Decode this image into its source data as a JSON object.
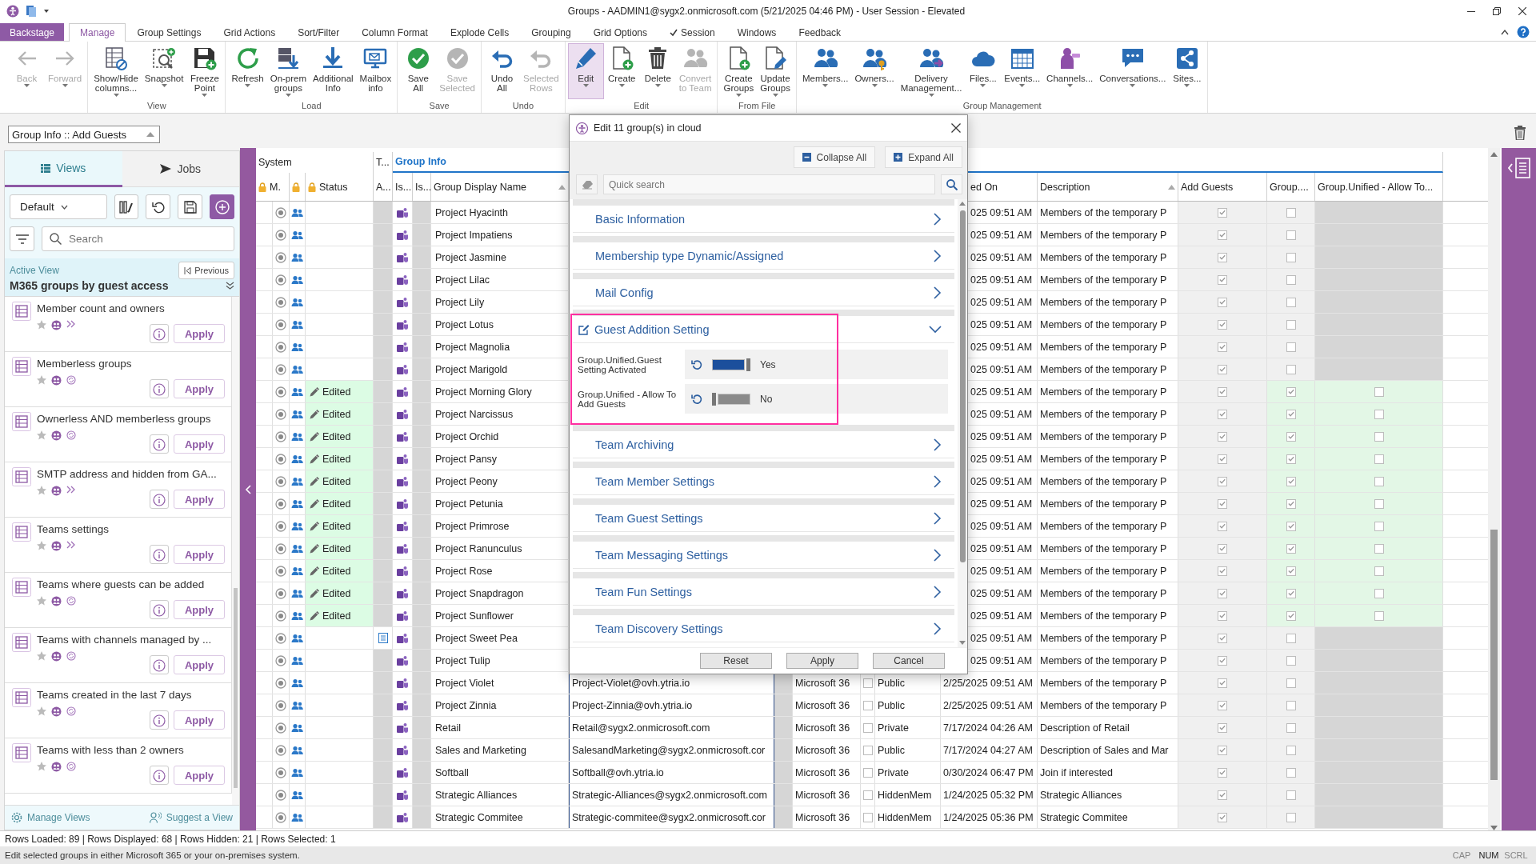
{
  "window": {
    "title": "Groups - AADMIN1@sygx2.onmicrosoft.com (5/21/2025 04:46 PM) - User Session - Elevated"
  },
  "menu": [
    {
      "label": "Backstage",
      "kind": "backstage",
      "selected": false,
      "checked": false
    },
    {
      "label": "Manage",
      "kind": "tab",
      "selected": true,
      "checked": false
    },
    {
      "label": "Group Settings",
      "kind": "tab",
      "selected": false,
      "checked": false
    },
    {
      "label": "Grid Actions",
      "kind": "tab",
      "selected": false,
      "checked": false
    },
    {
      "label": "Sort/Filter",
      "kind": "tab",
      "selected": false,
      "checked": false
    },
    {
      "label": "Column Format",
      "kind": "tab",
      "selected": false,
      "checked": false
    },
    {
      "label": "Explode Cells",
      "kind": "tab",
      "selected": false,
      "checked": false
    },
    {
      "label": "Grouping",
      "kind": "tab",
      "selected": false,
      "checked": false
    },
    {
      "label": "Grid Options",
      "kind": "tab",
      "selected": false,
      "checked": false
    },
    {
      "label": "Session",
      "kind": "tab",
      "selected": false,
      "checked": true
    },
    {
      "label": "Windows",
      "kind": "tab",
      "selected": false,
      "checked": false
    },
    {
      "label": "Feedback",
      "kind": "tab",
      "selected": false,
      "checked": false
    }
  ],
  "ribbon": {
    "groups": [
      {
        "buttons": [
          {
            "label": "Back",
            "disabled": true,
            "dropdown": true,
            "selected": false
          },
          {
            "label": "Forward",
            "disabled": true,
            "dropdown": true,
            "selected": false
          }
        ]
      },
      {
        "label": "View",
        "buttons": [
          {
            "label": "Show/Hide\ncolumns...",
            "disabled": false,
            "dropdown": true,
            "selected": false
          },
          {
            "label": "Snapshot",
            "disabled": false,
            "dropdown": true,
            "selected": false
          },
          {
            "label": "Freeze\nPoint",
            "disabled": false,
            "dropdown": true,
            "selected": false
          }
        ]
      },
      {
        "label": "Load",
        "buttons": [
          {
            "label": "Refresh",
            "disabled": false,
            "dropdown": true,
            "selected": false
          },
          {
            "label": "On-prem\ngroups",
            "disabled": false,
            "dropdown": true,
            "selected": false
          },
          {
            "label": "Additional\nInfo",
            "disabled": false,
            "dropdown": false,
            "selected": false
          },
          {
            "label": "Mailbox\ninfo",
            "disabled": false,
            "dropdown": false,
            "selected": false
          }
        ]
      },
      {
        "label": "Save",
        "buttons": [
          {
            "label": "Save\nAll",
            "disabled": false,
            "dropdown": false,
            "selected": false
          },
          {
            "label": "Save\nSelected",
            "disabled": true,
            "dropdown": false,
            "selected": false
          }
        ]
      },
      {
        "label": "Undo",
        "buttons": [
          {
            "label": "Undo\nAll",
            "disabled": false,
            "dropdown": false,
            "selected": false
          },
          {
            "label": "Selected\nRows",
            "disabled": true,
            "dropdown": false,
            "selected": false
          }
        ]
      },
      {
        "label": "Edit",
        "buttons": [
          {
            "label": "Edit",
            "disabled": false,
            "dropdown": true,
            "selected": true
          },
          {
            "label": "Create",
            "disabled": false,
            "dropdown": true,
            "selected": false
          },
          {
            "label": "Delete",
            "disabled": false,
            "dropdown": true,
            "selected": false
          },
          {
            "label": "Convert\nto Team",
            "disabled": true,
            "dropdown": false,
            "selected": false
          }
        ]
      },
      {
        "label": "From File",
        "buttons": [
          {
            "label": "Create\nGroups",
            "disabled": false,
            "dropdown": true,
            "selected": false
          },
          {
            "label": "Update\nGroups",
            "disabled": false,
            "dropdown": true,
            "selected": false
          }
        ]
      },
      {
        "label": "Group Management",
        "buttons": [
          {
            "label": "Members...",
            "disabled": false,
            "dropdown": true,
            "selected": false
          },
          {
            "label": "Owners...",
            "disabled": false,
            "dropdown": true,
            "selected": false
          },
          {
            "label": "Delivery\nManagement...",
            "disabled": false,
            "dropdown": true,
            "selected": false
          },
          {
            "label": "Files...",
            "disabled": false,
            "dropdown": true,
            "selected": false
          },
          {
            "label": "Events...",
            "disabled": false,
            "dropdown": true,
            "selected": false
          },
          {
            "label": "Channels...",
            "disabled": false,
            "dropdown": true,
            "selected": false
          },
          {
            "label": "Conversations...",
            "disabled": false,
            "dropdown": true,
            "selected": false
          },
          {
            "label": "Sites...",
            "disabled": false,
            "dropdown": true,
            "selected": false
          }
        ]
      }
    ]
  },
  "view_selector": "Group Info :: Add Guests",
  "views_panel": {
    "tabs": [
      {
        "label": "Views",
        "selected": true
      },
      {
        "label": "Jobs",
        "selected": false
      }
    ],
    "preset": "Default",
    "search": {
      "placeholder": "Search"
    },
    "active_view": {
      "label": "Active View",
      "previous": "Previous",
      "name": "M365 groups by guest access"
    },
    "items": [
      {
        "title": "Member count and owners",
        "kind": "chevrons",
        "apply": "Apply"
      },
      {
        "title": "Memberless groups",
        "kind": "cycle",
        "apply": "Apply"
      },
      {
        "title": "Ownerless AND memberless groups",
        "kind": "cycle",
        "apply": "Apply"
      },
      {
        "title": "SMTP address and hidden from GA...",
        "kind": "chevrons",
        "apply": "Apply"
      },
      {
        "title": "Teams settings",
        "kind": "chevrons",
        "apply": "Apply"
      },
      {
        "title": "Teams where guests can be added",
        "kind": "cycle",
        "apply": "Apply"
      },
      {
        "title": "Teams with channels managed by ...",
        "kind": "cycle",
        "apply": "Apply"
      },
      {
        "title": "Teams created in the last 7 days",
        "kind": "cycle",
        "apply": "Apply"
      },
      {
        "title": "Teams with less than 2 owners",
        "kind": "cycle",
        "apply": "Apply"
      }
    ],
    "footer": [
      "Manage Views",
      "Suggest a View"
    ]
  },
  "grid": {
    "groups": [
      {
        "label": "System",
        "selected": false
      },
      {
        "label": "T...",
        "selected": false
      },
      {
        "label": "Group Info",
        "selected": true
      }
    ],
    "columns": [
      {
        "label": "M.",
        "locked": true,
        "sorted": false
      },
      {
        "locked": true,
        "sorted": false
      },
      {
        "label": "Status",
        "locked": true,
        "sorted": false
      },
      {
        "label": "A...",
        "locked": false,
        "sorted": false
      },
      {
        "label": "Is...",
        "locked": false,
        "sorted": false
      },
      {
        "label": "Is...",
        "locked": false,
        "sorted": false
      },
      {
        "label": "Group Display Name",
        "locked": false,
        "sorted": true
      },
      {
        "label": "ed On",
        "locked": false,
        "sorted": false
      },
      {
        "label": "Description",
        "locked": false,
        "sorted": true
      },
      {
        "label": "Add Guests",
        "locked": false,
        "sorted": false
      },
      {
        "label": "Group....",
        "locked": false,
        "sorted": false
      },
      {
        "label": "Group.Unified - Allow To...",
        "locked": false,
        "sorted": false
      }
    ],
    "rows": [
      {
        "name": "Project Hyacinth",
        "flag": false,
        "created": "025 09:51 AM",
        "description": "Members of the temporary P",
        "add_guests": true,
        "guest_setting": false
      },
      {
        "name": "Project Impatiens",
        "flag": false,
        "created": "025 09:51 AM",
        "description": "Members of the temporary P",
        "add_guests": true,
        "guest_setting": false
      },
      {
        "name": "Project Jasmine",
        "flag": false,
        "created": "025 09:51 AM",
        "description": "Members of the temporary P",
        "add_guests": true,
        "guest_setting": false
      },
      {
        "name": "Project Lilac",
        "flag": false,
        "created": "025 09:51 AM",
        "description": "Members of the temporary P",
        "add_guests": true,
        "guest_setting": false
      },
      {
        "name": "Project Lily",
        "flag": false,
        "created": "025 09:51 AM",
        "description": "Members of the temporary P",
        "add_guests": true,
        "guest_setting": false
      },
      {
        "name": "Project Lotus",
        "flag": false,
        "created": "025 09:51 AM",
        "description": "Members of the temporary P",
        "add_guests": true,
        "guest_setting": false
      },
      {
        "name": "Project Magnolia",
        "flag": false,
        "created": "025 09:51 AM",
        "description": "Members of the temporary P",
        "add_guests": true,
        "guest_setting": false
      },
      {
        "name": "Project Marigold",
        "flag": false,
        "created": "025 09:51 AM",
        "description": "Members of the temporary P",
        "add_guests": true,
        "guest_setting": false
      },
      {
        "name": "Project Morning Glory",
        "flag": false,
        "status": "Edited",
        "created": "025 09:51 AM",
        "description": "Members of the temporary P",
        "add_guests": true,
        "guest_setting": true,
        "allow_add": false
      },
      {
        "name": "Project Narcissus",
        "flag": false,
        "status": "Edited",
        "created": "025 09:51 AM",
        "description": "Members of the temporary P",
        "add_guests": true,
        "guest_setting": true,
        "allow_add": false
      },
      {
        "name": "Project Orchid",
        "flag": false,
        "status": "Edited",
        "created": "025 09:51 AM",
        "description": "Members of the temporary P",
        "add_guests": true,
        "guest_setting": true,
        "allow_add": false
      },
      {
        "name": "Project Pansy",
        "flag": false,
        "status": "Edited",
        "created": "025 09:51 AM",
        "description": "Members of the temporary P",
        "add_guests": true,
        "guest_setting": true,
        "allow_add": false
      },
      {
        "name": "Project Peony",
        "flag": false,
        "status": "Edited",
        "created": "025 09:51 AM",
        "description": "Members of the temporary P",
        "add_guests": true,
        "guest_setting": true,
        "allow_add": false
      },
      {
        "name": "Project Petunia",
        "flag": false,
        "status": "Edited",
        "created": "025 09:51 AM",
        "description": "Members of the temporary P",
        "add_guests": true,
        "guest_setting": true,
        "allow_add": false
      },
      {
        "name": "Project Primrose",
        "flag": false,
        "status": "Edited",
        "created": "025 09:51 AM",
        "description": "Members of the temporary P",
        "add_guests": true,
        "guest_setting": true,
        "allow_add": false
      },
      {
        "name": "Project Ranunculus",
        "flag": false,
        "status": "Edited",
        "created": "025 09:51 AM",
        "description": "Members of the temporary P",
        "add_guests": true,
        "guest_setting": true,
        "allow_add": false
      },
      {
        "name": "Project Rose",
        "flag": false,
        "status": "Edited",
        "created": "025 09:51 AM",
        "description": "Members of the temporary P",
        "add_guests": true,
        "guest_setting": true,
        "allow_add": false
      },
      {
        "name": "Project Snapdragon",
        "flag": false,
        "status": "Edited",
        "created": "025 09:51 AM",
        "description": "Members of the temporary P",
        "add_guests": true,
        "guest_setting": true,
        "allow_add": false
      },
      {
        "name": "Project Sunflower",
        "flag": false,
        "status": "Edited",
        "created": "025 09:51 AM",
        "description": "Members of the temporary P",
        "add_guests": true,
        "guest_setting": true,
        "allow_add": false
      },
      {
        "name": "Project Sweet Pea",
        "flag": true,
        "created": "025 09:51 AM",
        "description": "Members of the temporary P",
        "add_guests": true,
        "guest_setting": false
      },
      {
        "name": "Project Tulip",
        "flag": false,
        "created": "025 09:51 AM",
        "description": "Members of the temporary P",
        "add_guests": true,
        "guest_setting": false
      },
      {
        "name": "Project Violet",
        "flag": false,
        "email": "Project-Violet@ovh.ytria.io",
        "type": "Microsoft 36",
        "checkbox": false,
        "visibility": "Public",
        "created": "2/25/2025 09:51 AM",
        "description": "Members of the temporary P",
        "add_guests": true,
        "guest_setting": false
      },
      {
        "name": "Project Zinnia",
        "flag": false,
        "email": "Project-Zinnia@ovh.ytria.io",
        "type": "Microsoft 36",
        "checkbox": false,
        "visibility": "Public",
        "created": "2/25/2025 09:51 AM",
        "description": "Members of the temporary P",
        "add_guests": true,
        "guest_setting": false
      },
      {
        "name": "Retail",
        "flag": false,
        "email": "Retail@sygx2.onmicrosoft.com",
        "type": "Microsoft 36",
        "checkbox": false,
        "visibility": "Private",
        "created": "7/17/2024 04:26 AM",
        "description": "Description of Retail",
        "add_guests": true,
        "guest_setting": false
      },
      {
        "name": "Sales and Marketing",
        "flag": false,
        "email": "SalesandMarketing@sygx2.onmicrosoft.cor",
        "type": "Microsoft 36",
        "checkbox": false,
        "visibility": "Public",
        "created": "7/17/2024 04:27 AM",
        "description": "Description of Sales and Mar",
        "add_guests": true,
        "guest_setting": false
      },
      {
        "name": "Softball",
        "flag": false,
        "email": "Softball@ovh.ytria.io",
        "type": "Microsoft 36",
        "checkbox": false,
        "visibility": "Private",
        "created": "0/30/2024 06:47 PM",
        "description": "Join if interested",
        "add_guests": true,
        "guest_setting": false
      },
      {
        "name": "Strategic Alliances",
        "flag": false,
        "email": "Strategic-Alliances@sygx2.onmicrosoft.com",
        "type": "Microsoft 36",
        "checkbox": false,
        "visibility": "HiddenMem",
        "created": "1/24/2025 05:32 PM",
        "description": "Strategic Alliances",
        "add_guests": true,
        "guest_setting": false
      },
      {
        "name": "Strategic Commitee",
        "flag": false,
        "email": "Strategic-commitee@sygx2.onmicrosoft.cor",
        "type": "Microsoft 36",
        "checkbox": false,
        "visibility": "HiddenMem",
        "created": "1/24/2025 05:36 PM",
        "description": "Strategic Commitee",
        "add_guests": true,
        "guest_setting": false
      }
    ]
  },
  "dialog": {
    "title": "Edit 11 group(s) in cloud",
    "collapse_all": "Collapse All",
    "expand_all": "Expand All",
    "search": {
      "placeholder": "Quick search"
    },
    "sections": [
      {
        "title": "Basic Information",
        "expanded": false,
        "highlighted": false,
        "edited": false
      },
      {
        "title": "Membership type Dynamic/Assigned",
        "expanded": false,
        "highlighted": false,
        "edited": false
      },
      {
        "title": "Mail Config",
        "expanded": false,
        "highlighted": false,
        "edited": false
      },
      {
        "title": "Guest Addition Setting",
        "expanded": true,
        "highlighted": true,
        "edited": true,
        "settings": [
          {
            "label": "Group.Unified.Guest Setting Activated",
            "on": true,
            "value": "Yes"
          },
          {
            "label": "Group.Unified - Allow To Add Guests",
            "on": false,
            "value": "No"
          }
        ]
      },
      {
        "title": "Team Archiving",
        "expanded": false,
        "highlighted": false,
        "edited": false
      },
      {
        "title": "Team Member Settings",
        "expanded": false,
        "highlighted": false,
        "edited": false
      },
      {
        "title": "Team Guest Settings",
        "expanded": false,
        "highlighted": false,
        "edited": false
      },
      {
        "title": "Team Messaging Settings",
        "expanded": false,
        "highlighted": false,
        "edited": false
      },
      {
        "title": "Team Fun Settings",
        "expanded": false,
        "highlighted": false,
        "edited": false
      },
      {
        "title": "Team Discovery Settings",
        "expanded": false,
        "highlighted": false,
        "edited": false
      }
    ],
    "buttons": [
      "Reset",
      "Apply",
      "Cancel"
    ]
  },
  "status_bar": {
    "summary": "Rows Loaded: 89 | Rows Displayed: 68 | Rows Hidden: 21 | Rows Selected: 1",
    "hint": "Edit selected groups in either Microsoft 365 or your on-premises system.",
    "indicators": [
      {
        "label": "CAP",
        "on": false
      },
      {
        "label": "NUM",
        "on": true
      },
      {
        "label": "SCRL",
        "on": false
      }
    ]
  }
}
